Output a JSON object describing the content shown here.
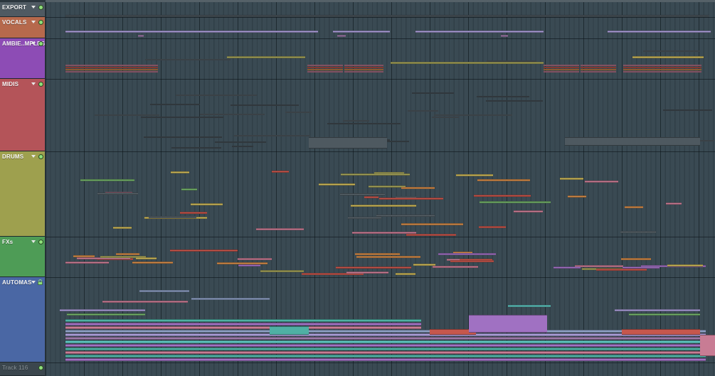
{
  "playlist": {
    "tracks": [
      {
        "name": "EXPORT",
        "color": "#4f5a62",
        "state": "on",
        "icon": "led-indicator"
      },
      {
        "name": "VOCALS",
        "color": "#b6694c",
        "state": "on",
        "icon": "led-indicator"
      },
      {
        "name": "AMBIE..MPLES",
        "color": "#8d4cb5",
        "state": "on",
        "icon": "led-indicator"
      },
      {
        "name": "MIDIS",
        "color": "#b45459",
        "state": "on",
        "icon": "led-indicator"
      },
      {
        "name": "DRUMS",
        "color": "#9ea04e",
        "state": "on",
        "icon": "led-indicator"
      },
      {
        "name": "FXs",
        "color": "#4e9c56",
        "state": "on",
        "icon": "led-indicator"
      },
      {
        "name": "AUTOMAS",
        "color": "#4a67a4",
        "state": "locked",
        "icon": "lock-icon"
      },
      {
        "name": "Track 116",
        "color": "#3b464d",
        "state": "on",
        "icon": "led-indicator"
      }
    ]
  }
}
